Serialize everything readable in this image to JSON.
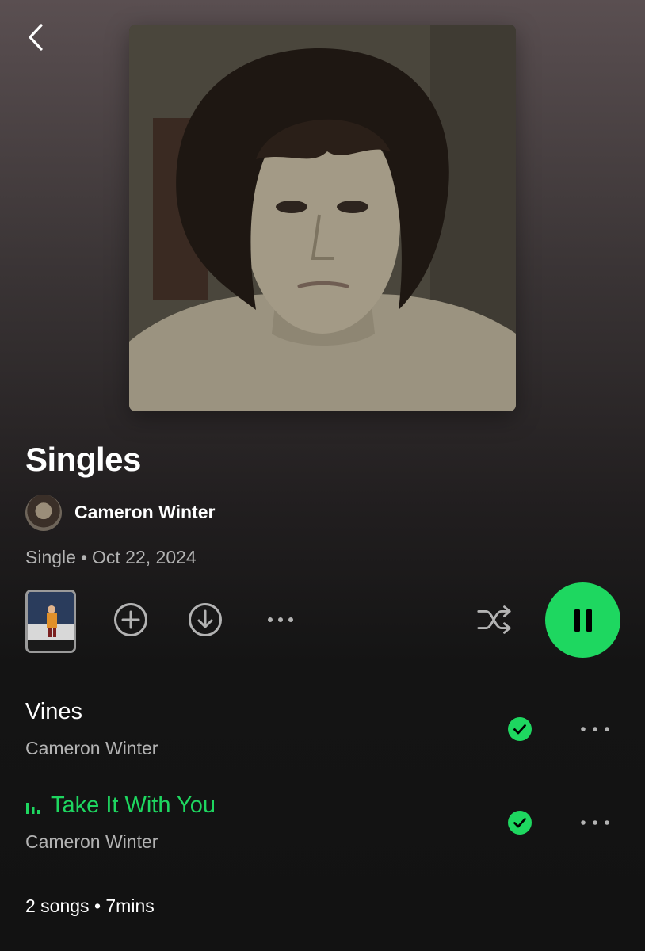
{
  "header": {
    "back_icon": "chevron-left-icon"
  },
  "album": {
    "title": "Singles",
    "artist": "Cameron Winter",
    "type": "Single",
    "separator": "•",
    "release_date": "Oct 22, 2024"
  },
  "actions": {
    "add_icon": "add-circle-icon",
    "download_icon": "download-circle-icon",
    "more_icon": "more-horizontal-icon",
    "shuffle_icon": "shuffle-icon",
    "play_state": "playing",
    "pause_icon": "pause-icon"
  },
  "tracks": [
    {
      "title": "Vines",
      "artist": "Cameron Winter",
      "downloaded": true,
      "playing": false
    },
    {
      "title": "Take It With You",
      "artist": "Cameron Winter",
      "downloaded": true,
      "playing": true
    }
  ],
  "summary": "2 songs • 7mins",
  "colors": {
    "accent": "#1ed760",
    "secondary_text": "#b3b3b3",
    "background": "#121212"
  }
}
